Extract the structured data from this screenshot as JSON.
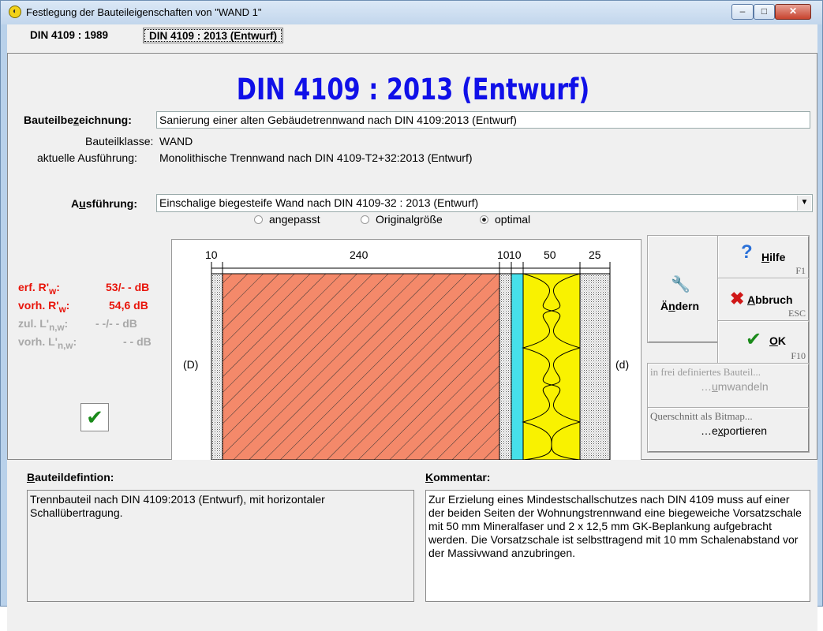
{
  "window": {
    "title": "Festlegung der Bauteileigenschaften von \"WAND 1\"",
    "min": "–",
    "max": "□",
    "close": "✕"
  },
  "tabs": [
    "DIN 4109 : 1989",
    "DIN 4109 : 2013 (Entwurf)"
  ],
  "header": {
    "title": "DIN 4109 : 2013 (Entwurf)"
  },
  "form": {
    "designation_label": "Bauteilbezeichnung:",
    "designation_value": "Sanierung einer alten Gebäudetrennwand nach DIN 4109:2013 (Entwurf)",
    "class_label": "Bauteilklasse:",
    "class_value": "WAND",
    "current_label": "aktuelle Ausführung:",
    "current_value": "Monolithische Trennwand nach DIN 4109-T2+32:2013 (Entwurf)",
    "execution_label": "Ausführung:",
    "execution_value": "Einschalige biegesteife Wand nach DIN 4109-32 : 2013 (Entwurf)"
  },
  "radios": [
    {
      "label": "angepasst",
      "checked": false
    },
    {
      "label": "Originalgröße",
      "checked": false
    },
    {
      "label": "optimal",
      "checked": true
    }
  ],
  "diagram": {
    "dimensions": [
      "10",
      "240",
      "10",
      "10",
      "50",
      "25"
    ],
    "left_label": "(D)",
    "right_label": "(d)"
  },
  "results": {
    "erf_label": "erf. R'w:",
    "erf_value": "53/- - dB",
    "vorh_label": "vorh. R'w:",
    "vorh_value": "54,6 dB",
    "zul_label": "zul. L'n,w:",
    "zul_value": "- -/- - dB",
    "vorhl_label": "vorh. L'n,w:",
    "vorhl_value": "- - dB",
    "status_icon": "check-icon"
  },
  "actions": {
    "aendern": "Ändern",
    "hilfe": "Hilfe",
    "hilfe_key": "F1",
    "abbruch": "Abbruch",
    "abbruch_key": "ESC",
    "ok": "OK",
    "ok_key": "F10",
    "convert_line1": "in frei definiertes Bauteil...",
    "convert_line2": "...umwandeln",
    "export_line1": "Querschnitt als Bitmap...",
    "export_line2": "...exportieren"
  },
  "definition": {
    "label": "Bauteildefintion:",
    "text": "Trennbauteil nach DIN 4109:2013 (Entwurf), mit horizontaler Schallübertragung."
  },
  "comment": {
    "label": "Kommentar:",
    "text": "Zur Erzielung eines Mindestschallschutzes nach DIN 4109 muss auf einer der beiden Seiten der Wohnungstrennwand eine biegeweiche Vorsatzschale mit 50 mm Mineralfaser und 2 x 12,5 mm GK-Beplankung aufgebracht werden. Die Vorsatzschale ist selbsttragend mit 10 mm Schalenabstand vor der Massivwand anzubringen."
  },
  "colors": {
    "title_blue": "#1010e8",
    "result_red": "#e8140a",
    "masonry": "#f4896a",
    "cavity": "#46e0ea",
    "insulation": "#f9f200"
  }
}
